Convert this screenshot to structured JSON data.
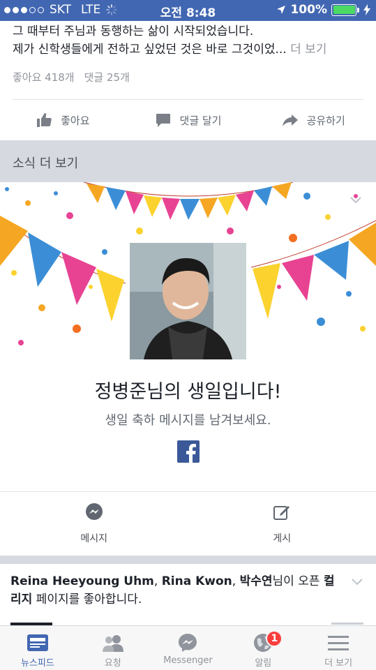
{
  "status_bar": {
    "carrier": "SKT",
    "network": "LTE",
    "time": "오전 8:48",
    "battery_percent": "100%",
    "signal_bars_filled": 3,
    "signal_bars_total": 5
  },
  "post": {
    "line1": "그 때부터 주님과 동행하는 삶이 시작되었습니다.",
    "line2": "제가 신학생들에게 전하고 싶었던 것은 바로 그것이었...",
    "more_label": "더 보기",
    "likes": "좋아요 418개",
    "comments": "댓글 25개",
    "actions": {
      "like": "좋아요",
      "comment": "댓글 달기",
      "share": "공유하기"
    }
  },
  "news_section": {
    "title": "소식 더 보기"
  },
  "birthday_card": {
    "title": "정병준님의 생일입니다!",
    "subtitle": "생일 축하 메시지를 남겨보세요.",
    "actions": {
      "message": "메시지",
      "post": "게시"
    }
  },
  "activity_story": {
    "person1": "Reina Heeyoung Uhm",
    "sep1": ", ",
    "person2": "Rina Kwon",
    "sep2": ", ",
    "person3": "박수연",
    "mid": "님이 오픈 ",
    "page_name": "컬리지",
    "tail": " 페이지를 좋아합니다."
  },
  "tab_bar": {
    "tabs": [
      {
        "label": "뉴스피드",
        "icon": "news-feed-icon",
        "active": true
      },
      {
        "label": "요청",
        "icon": "friend-requests-icon",
        "active": false
      },
      {
        "label": "Messenger",
        "icon": "messenger-icon",
        "active": false
      },
      {
        "label": "알림",
        "icon": "globe-notifications-icon",
        "active": false,
        "badge": "1"
      },
      {
        "label": "더 보기",
        "icon": "menu-icon",
        "active": false
      }
    ]
  },
  "colors": {
    "brand_blue": "#4267b2",
    "badge_red": "#fa3e3e",
    "battery_green": "#4cd964",
    "section_gray": "#d6d9df"
  }
}
